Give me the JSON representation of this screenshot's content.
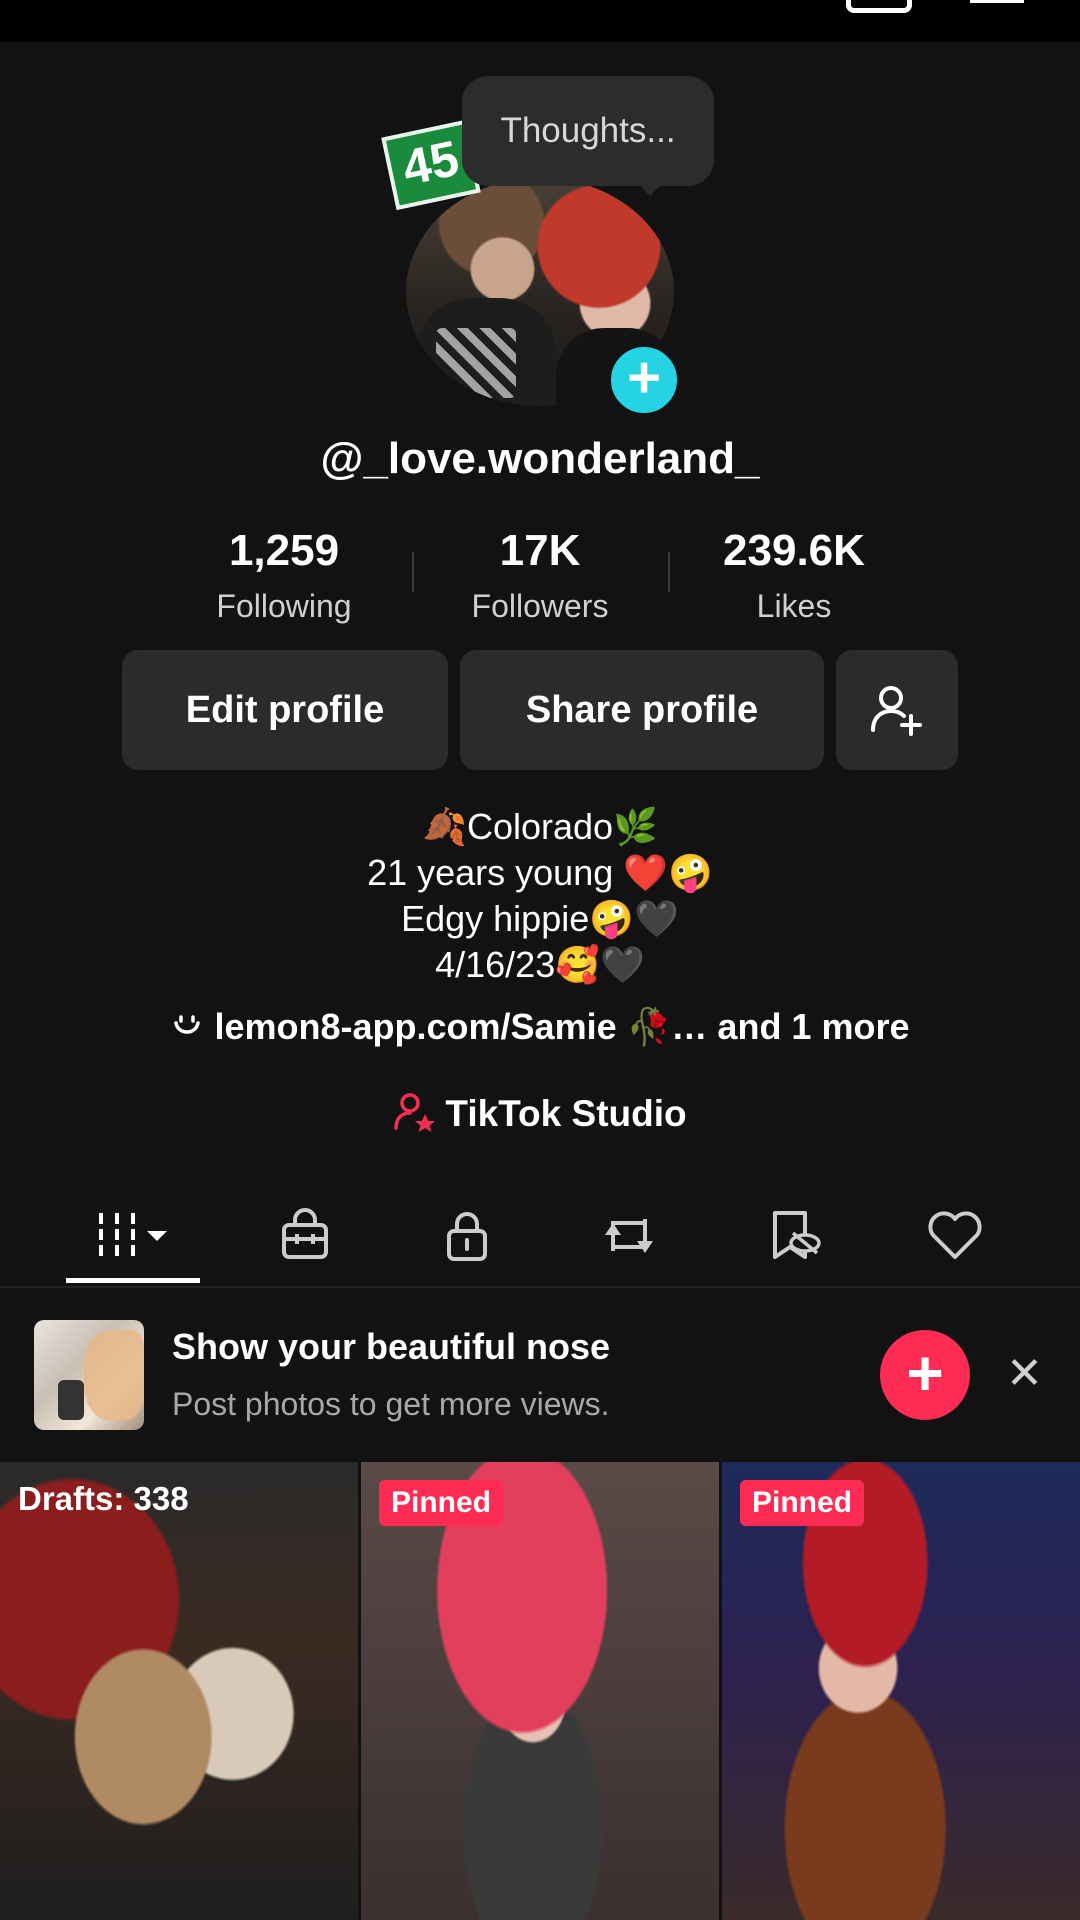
{
  "bubble": {
    "text": "Thoughts..."
  },
  "badge": {
    "text": "45"
  },
  "profile": {
    "username": "@_love.wonderland_",
    "stats": [
      {
        "value": "1,259",
        "label": "Following"
      },
      {
        "value": "17K",
        "label": "Followers"
      },
      {
        "value": "239.6K",
        "label": "Likes"
      }
    ]
  },
  "buttons": {
    "edit_profile": "Edit profile",
    "share_profile": "Share profile",
    "add_friend_icon": "add-user-icon"
  },
  "bio": {
    "line1": "🍂Colorado🌿",
    "line2": "21 years young ❤️🤪",
    "line3": "Edgy hippie🤪🖤",
    "line4": "4/16/23🥰🖤",
    "link": "lemon8-app.com/Samie 🥀…  and 1 more"
  },
  "studio": {
    "label": "TikTok Studio"
  },
  "tabs": {
    "icons": [
      "videos-grid-icon",
      "shop-bag-icon",
      "lock-icon",
      "repost-icon",
      "favorites-hidden-icon",
      "heart-icon"
    ]
  },
  "promo": {
    "title": "Show your beautiful nose",
    "subtitle": "Post photos to get more views."
  },
  "grid": [
    {
      "label": "Drafts: 338"
    },
    {
      "label": "Pinned"
    },
    {
      "label": "Pinned"
    }
  ],
  "colors": {
    "background": "#121212",
    "accent_pink": "#fe2c55",
    "accent_cyan": "#25d3e3",
    "button_bg": "#2b2b2b"
  }
}
